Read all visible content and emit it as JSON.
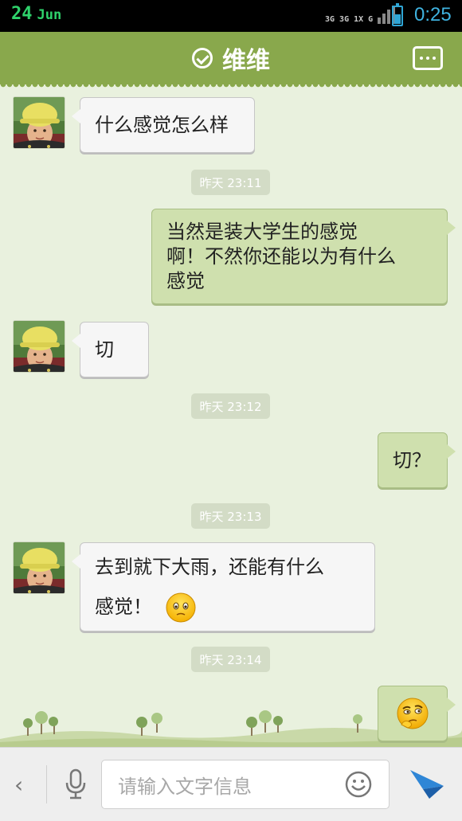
{
  "status_bar": {
    "date_day": "24",
    "date_month": "Jun",
    "network_labels": [
      "3G",
      "3G",
      "1X",
      "G"
    ],
    "time": "0:25",
    "battery_level": 0.55,
    "battery_color": "#2fa6d6"
  },
  "title_bar": {
    "contact_name": "维维",
    "verified_icon": "check-circle-icon",
    "menu_icon": "more-options-icon",
    "background_color": "#89a84c"
  },
  "messages": [
    {
      "direction": "in",
      "text": "什么感觉怎么样"
    },
    {
      "timestamp": "昨天 23:11"
    },
    {
      "direction": "out",
      "lines": [
        "当然是装大学生的感觉",
        "啊！不然你还能以为有什么",
        "感觉"
      ]
    },
    {
      "direction": "in",
      "text": "切"
    },
    {
      "timestamp": "昨天 23:12"
    },
    {
      "direction": "out",
      "text": "切？"
    },
    {
      "timestamp": "昨天 23:13"
    },
    {
      "direction": "in",
      "lines": [
        "去到就下大雨，还能有什么",
        "感觉！"
      ],
      "emoji": "smiley-emoji"
    },
    {
      "timestamp": "昨天 23:14"
    },
    {
      "direction": "out",
      "emoji": "thinking-emoji"
    }
  ],
  "input_bar": {
    "back_icon": "chevron-left-icon",
    "mic_icon": "microphone-icon",
    "placeholder": "请输入文字信息",
    "emoji_icon": "smiley-face-icon",
    "send_icon": "paper-plane-icon"
  },
  "colors": {
    "chat_background": "#e9f1de",
    "outgoing_bubble": "#cfe0ae",
    "incoming_bubble": "#f6f6f6"
  }
}
